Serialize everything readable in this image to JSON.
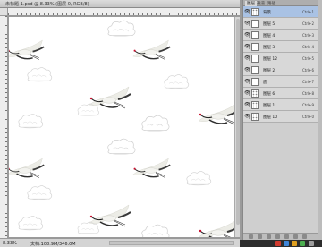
{
  "document": {
    "title": "未标题-1.psd @ 8.33% (图层 0, RGB/8)",
    "zoom": "8.33%",
    "doc_info": "文档:108.9M/346.0M"
  },
  "panel": {
    "tabs": [
      "图层",
      "通道",
      "路径"
    ],
    "layers": [
      {
        "name": "背景",
        "shortcut": "Ctrl+1",
        "thumb": "pattern",
        "selected": true
      },
      {
        "name": "图层 5",
        "shortcut": "Ctrl+2",
        "thumb": "white",
        "selected": false
      },
      {
        "name": "图层 4",
        "shortcut": "Ctrl+3",
        "thumb": "white",
        "selected": false
      },
      {
        "name": "图层 3",
        "shortcut": "Ctrl+4",
        "thumb": "white",
        "selected": false
      },
      {
        "name": "图层 12",
        "shortcut": "Ctrl+5",
        "thumb": "white",
        "selected": false
      },
      {
        "name": "图层 2",
        "shortcut": "Ctrl+6",
        "thumb": "white",
        "selected": false
      },
      {
        "name": "底",
        "shortcut": "Ctrl+7",
        "thumb": "bg",
        "selected": false
      },
      {
        "name": "图层 6",
        "shortcut": "Ctrl+8",
        "thumb": "pattern",
        "selected": false
      },
      {
        "name": "图层 1",
        "shortcut": "Ctrl+9",
        "thumb": "pattern",
        "selected": false
      },
      {
        "name": "图层 10",
        "shortcut": "Ctrl+0",
        "thumb": "pattern",
        "selected": false
      }
    ]
  },
  "icons": {
    "visibility": "eye-icon",
    "crane": "crane-icon",
    "cloud": "cloud-icon"
  },
  "colors": {
    "selected_layer": "#a9c2e4",
    "crane_body": "#f2f2ee",
    "crane_wing_tip": "#3a3a3a",
    "crane_crown": "#c8102e",
    "cloud_line": "#c8c8c8"
  }
}
